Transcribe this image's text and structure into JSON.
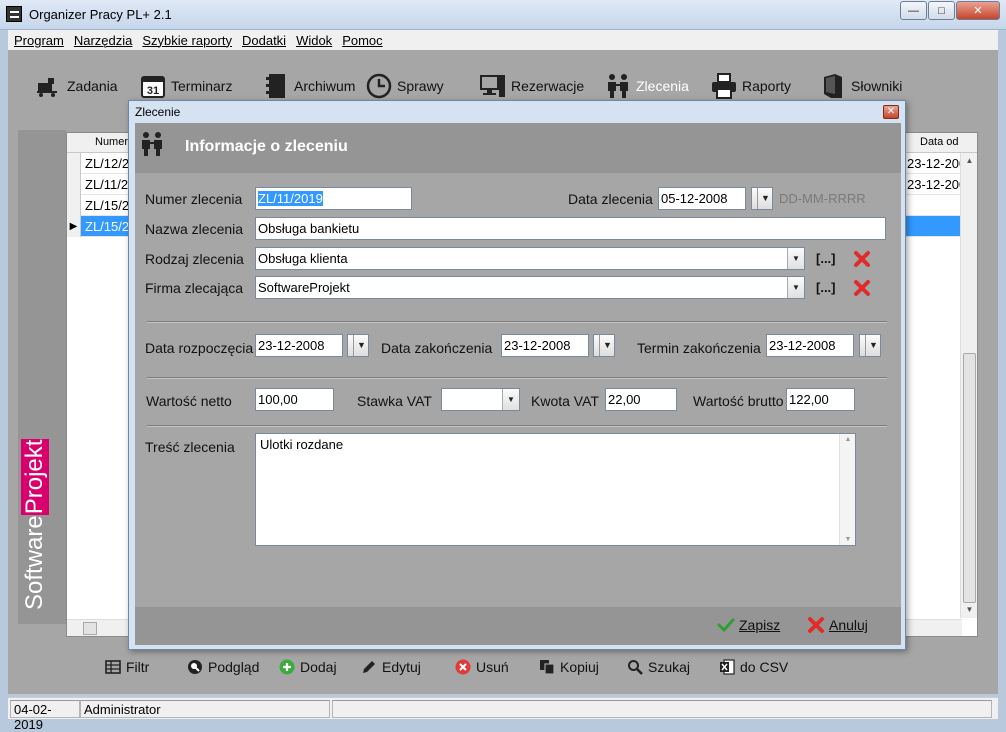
{
  "window": {
    "title": "Organizer Pracy PL+ 2.1"
  },
  "menu": [
    "Program",
    "Narzędzia",
    "Szybkie raporty",
    "Dodatki",
    "Widok",
    "Pomoc"
  ],
  "toolbar": {
    "zadania": "Zadania",
    "terminarz": "Terminarz",
    "terminarz_day": "31",
    "archiwum": "Archiwum",
    "sprawy": "Sprawy",
    "rezerwacje": "Rezerwacje",
    "zlecenia": "Zlecenia",
    "raporty": "Raporty",
    "slowniki": "Słowniki"
  },
  "brand": {
    "part1": "Software",
    "part2": "Projekt",
    "accent": "#d8006c"
  },
  "grid": {
    "col_number": "Numer",
    "col_date": "Data od",
    "rows": [
      {
        "number": "ZL/12/2",
        "date": "23-12-200"
      },
      {
        "number": "ZL/11/2",
        "date": "23-12-200"
      },
      {
        "number": "ZL/15/2",
        "date": ""
      },
      {
        "number": "ZL/15/2",
        "date": ""
      }
    ]
  },
  "bottom": {
    "filtr": "Filtr",
    "podglad": "Podgląd",
    "dodaj": "Dodaj",
    "edytuj": "Edytuj",
    "usun": "Usuń",
    "kopiuj": "Kopiuj",
    "szukaj": "Szukaj",
    "csv": "do CSV"
  },
  "status": {
    "date": "04-02-2019",
    "user": "Administrator"
  },
  "dialog": {
    "title": "Zlecenie",
    "header": "Informacje o zleceniu",
    "numer_label": "Numer zlecenia",
    "numer_value": "ZL/11/2019",
    "data_label": "Data zlecenia",
    "data_value": "05-12-2008",
    "date_format_hint": "DD-MM-RRRR",
    "nazwa_label": "Nazwa zlecenia",
    "nazwa_value": "Obsługa bankietu",
    "rodzaj_label": "Rodzaj zlecenia",
    "rodzaj_value": "Obsługa klienta",
    "firma_label": "Firma zlecająca",
    "firma_value": "SoftwareProjekt",
    "browse": "[...]",
    "start_label": "Data rozpoczęcia",
    "start_value": "23-12-2008",
    "end_label": "Data zakończenia",
    "end_value": "23-12-2008",
    "deadline_label": "Termin zakończenia",
    "deadline_value": "23-12-2008",
    "netto_label": "Wartość netto",
    "netto_value": "100,00",
    "vat_rate_label": "Stawka VAT",
    "vat_rate_value": "",
    "vat_amount_label": "Kwota VAT",
    "vat_amount_value": "22,00",
    "brutto_label": "Wartość brutto",
    "brutto_value": "122,00",
    "content_label": "Treść zlecenia",
    "content_value": "Ulotki rozdane",
    "save": "Zapisz",
    "cancel": "Anuluj"
  }
}
